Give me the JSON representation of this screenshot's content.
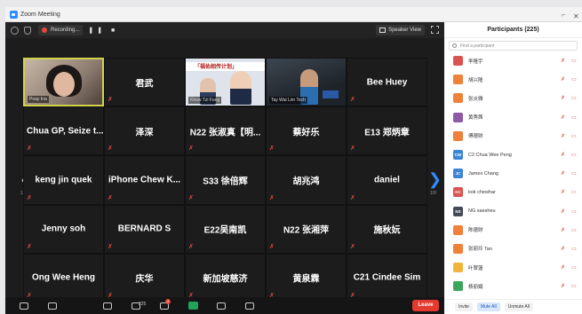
{
  "window": {
    "title": "Zoom Meeting"
  },
  "topbar": {
    "recording_label": "Recording...",
    "rec_controls": "❚❚ ■",
    "speaker_view_label": "Speaker View"
  },
  "videos": {
    "woman_caption": "Poay Ina",
    "banner_text": "「福佑相传计划」",
    "banner_caption": "Khow Tzi Fung",
    "lab_caption": "Tay Wai Lim Tech"
  },
  "pages": {
    "left": "1/9",
    "right": "1/9"
  },
  "grid": [
    {
      "label": "",
      "kind": "woman"
    },
    {
      "label": "君武",
      "kind": "name"
    },
    {
      "label": "",
      "kind": "banner"
    },
    {
      "label": "",
      "kind": "lab"
    },
    {
      "label": "Bee Huey",
      "kind": "name"
    },
    {
      "label": "Chua GP, Seize t...",
      "kind": "name"
    },
    {
      "label": "泽深",
      "kind": "name"
    },
    {
      "label": "N22 张淑真【明...",
      "kind": "name"
    },
    {
      "label": "蔡好乐",
      "kind": "name"
    },
    {
      "label": "E13 郑炳章",
      "kind": "name"
    },
    {
      "label": "keng jin quek",
      "kind": "name"
    },
    {
      "label": "iPhone Chew K...",
      "kind": "name"
    },
    {
      "label": "S33 徐倍辉",
      "kind": "name"
    },
    {
      "label": "胡兆鸿",
      "kind": "name"
    },
    {
      "label": "daniel",
      "kind": "name"
    },
    {
      "label": "Jenny soh",
      "kind": "name"
    },
    {
      "label": "BERNARD S",
      "kind": "name"
    },
    {
      "label": "E22吴南凯",
      "kind": "name"
    },
    {
      "label": "N22 张湘萍",
      "kind": "name"
    },
    {
      "label": "施秋妧",
      "kind": "name"
    },
    {
      "label": "Ong Wee Heng",
      "kind": "name"
    },
    {
      "label": "庆华",
      "kind": "name"
    },
    {
      "label": "新加坡慈济",
      "kind": "name"
    },
    {
      "label": "黄泉霖",
      "kind": "name"
    },
    {
      "label": "C21 Cindee Sim",
      "kind": "name"
    }
  ],
  "toolbar": {
    "participants_count": "225",
    "chat_badge": "4",
    "leave_label": "Leave"
  },
  "participants": {
    "title": "Participants (225)",
    "search_placeholder": "Find a participant",
    "items": [
      {
        "initials": "",
        "name": "李隆宇",
        "color": "#d9534f"
      },
      {
        "initials": "",
        "name": "胡兴隆",
        "color": "#f0813a"
      },
      {
        "initials": "",
        "name": "张炎雅",
        "color": "#f0813a"
      },
      {
        "initials": "",
        "name": "黄秀茜",
        "color": "#8e5aa8"
      },
      {
        "initials": "",
        "name": "傅德财",
        "color": "#f0813a"
      },
      {
        "initials": "CW",
        "name": "C2 Chua Wee Peng",
        "color": "#3d84d4"
      },
      {
        "initials": "JC",
        "name": "James Chang",
        "color": "#3d84d4"
      },
      {
        "initials": "KC",
        "name": "kok chewhar",
        "color": "#d9534f"
      },
      {
        "initials": "NS",
        "name": "NG saesheu",
        "color": "#444a57"
      },
      {
        "initials": "",
        "name": "陈德财",
        "color": "#f0813a"
      },
      {
        "initials": "",
        "name": "张丽玲 Tan",
        "color": "#f0813a"
      },
      {
        "initials": "",
        "name": "叶翠蓮",
        "color": "#f2b33d"
      },
      {
        "initials": "",
        "name": "杨丽娟",
        "color": "#3ba55c"
      }
    ],
    "footer": {
      "invite": "Invite",
      "mute_all": "Mute All",
      "unmute_all": "Unmute All"
    }
  }
}
